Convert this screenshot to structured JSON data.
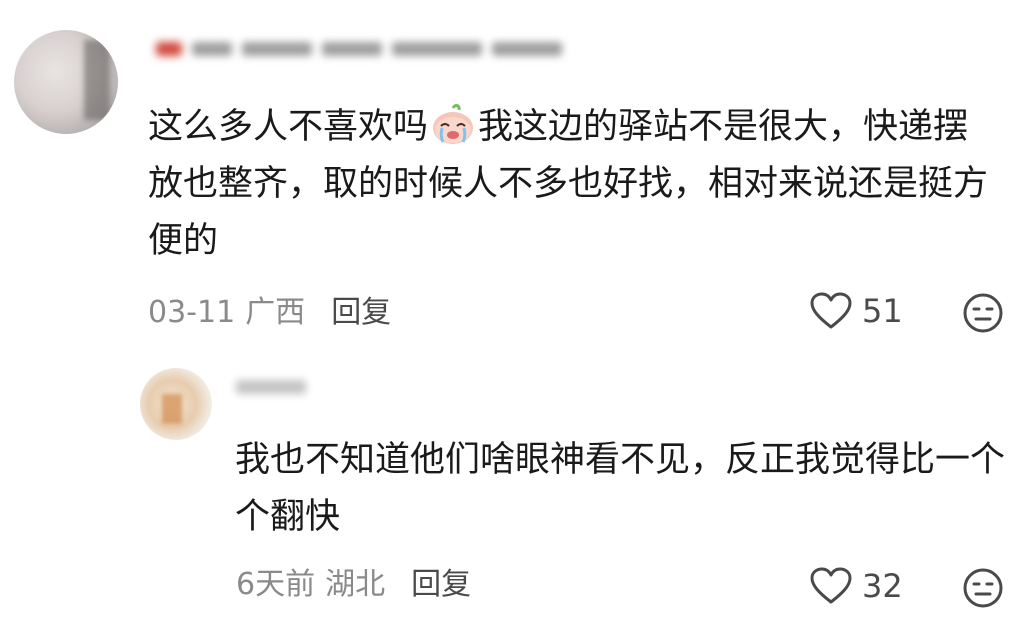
{
  "comments": [
    {
      "text_before_emoji": "这么多人不喜欢吗",
      "emoji": "crying-face-emoji",
      "text_after_emoji": "我这边的驿站不是很大，快递摆放也整齐，取的时候人不多也好找，相对来说还是挺方便的",
      "date": "03-11",
      "location": "广西",
      "reply_label": "回复",
      "likes": "51"
    },
    {
      "text": "我也不知道他们啥眼神看不见，反正我觉得比一个个翻快",
      "date": "6天前",
      "location": "湖北",
      "reply_label": "回复",
      "likes": "32"
    }
  ],
  "colors": {
    "text": "#1a1a1a",
    "meta": "#8a8a8a",
    "icon": "#4a4a4a"
  }
}
